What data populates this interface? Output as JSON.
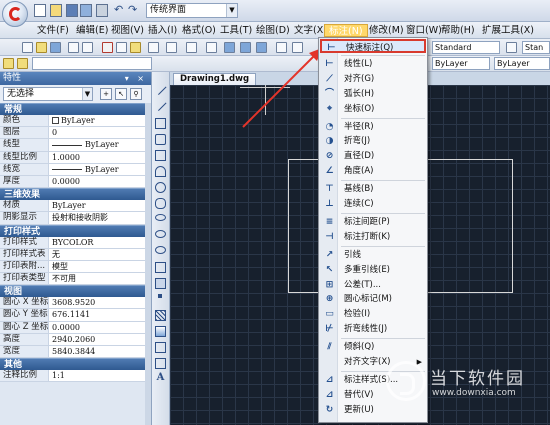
{
  "quick_access": {
    "workspace": "传统界面",
    "icons": [
      "new-icon",
      "open-icon",
      "save-icon",
      "saveas-icon",
      "print-icon",
      "undo-icon",
      "redo-icon"
    ]
  },
  "menubar": {
    "items": [
      "文件(F)",
      "编辑(E)",
      "视图(V)",
      "插入(I)",
      "格式(O)",
      "工具(T)",
      "绘图(D)",
      "文字(X)",
      "标注(N)",
      "修改(M)",
      "窗口(W)",
      "帮助(H)",
      "扩展工具(X)"
    ],
    "active_index": 8
  },
  "toolbar": {
    "style_combo": "Standard",
    "style_combo2": "Stan",
    "layer_combo": "ByLayer",
    "linetype_combo": "ByLayer"
  },
  "properties": {
    "title": "特性",
    "selection": "无选择",
    "sections": [
      {
        "name": "常规",
        "rows": [
          {
            "k": "颜色",
            "v": "ByLayer",
            "type": "color"
          },
          {
            "k": "图层",
            "v": "0",
            "type": "text"
          },
          {
            "k": "线型",
            "v": "ByLayer",
            "type": "rule"
          },
          {
            "k": "线型比例",
            "v": "1.0000",
            "type": "text"
          },
          {
            "k": "线宽",
            "v": "ByLayer",
            "type": "rule"
          },
          {
            "k": "厚度",
            "v": "0.0000",
            "type": "text"
          }
        ]
      },
      {
        "name": "三维效果",
        "rows": [
          {
            "k": "材质",
            "v": "ByLayer",
            "type": "text"
          },
          {
            "k": "阴影显示",
            "v": "投射和接收阴影",
            "type": "text"
          }
        ]
      },
      {
        "name": "打印样式",
        "rows": [
          {
            "k": "打印样式",
            "v": "BYCOLOR",
            "type": "text"
          },
          {
            "k": "打印样式表",
            "v": "无",
            "type": "text"
          },
          {
            "k": "打印表附...",
            "v": "模型",
            "type": "text"
          },
          {
            "k": "打印表类型",
            "v": "不可用",
            "type": "text"
          }
        ]
      },
      {
        "name": "视图",
        "rows": [
          {
            "k": "圆心 X 坐标",
            "v": "3608.9520",
            "type": "text"
          },
          {
            "k": "圆心 Y 坐标",
            "v": "676.1141",
            "type": "text"
          },
          {
            "k": "圆心 Z 坐标",
            "v": "0.0000",
            "type": "text"
          },
          {
            "k": "高度",
            "v": "2940.2060",
            "type": "text"
          },
          {
            "k": "宽度",
            "v": "5840.3844",
            "type": "text"
          }
        ]
      },
      {
        "name": "其他",
        "rows": [
          {
            "k": "注释比例",
            "v": "1:1",
            "type": "text"
          }
        ]
      }
    ]
  },
  "document": {
    "tab": "Drawing1.dwg"
  },
  "dim_menu": {
    "items": [
      {
        "label": "快速标注(Q)",
        "icon": "quick-dim-icon",
        "glyph": "⊢"
      },
      {
        "sep": true
      },
      {
        "label": "线性(L)",
        "icon": "linear-dim-icon",
        "glyph": "⊢"
      },
      {
        "label": "对齐(G)",
        "icon": "aligned-dim-icon",
        "glyph": "⟋"
      },
      {
        "label": "弧长(H)",
        "icon": "arc-length-icon",
        "glyph": "⌒"
      },
      {
        "label": "坐标(O)",
        "icon": "ordinate-icon",
        "glyph": "⌖"
      },
      {
        "sep": true
      },
      {
        "label": "半径(R)",
        "icon": "radius-icon",
        "glyph": "◔"
      },
      {
        "label": "折弯(J)",
        "icon": "jogged-icon",
        "glyph": "◑"
      },
      {
        "label": "直径(D)",
        "icon": "diameter-icon",
        "glyph": "⊘"
      },
      {
        "label": "角度(A)",
        "icon": "angular-icon",
        "glyph": "∠"
      },
      {
        "sep": true
      },
      {
        "label": "基线(B)",
        "icon": "baseline-icon",
        "glyph": "⊤"
      },
      {
        "label": "连续(C)",
        "icon": "continue-icon",
        "glyph": "⊥"
      },
      {
        "sep": true
      },
      {
        "label": "标注间距(P)",
        "icon": "dim-space-icon",
        "glyph": "≡"
      },
      {
        "label": "标注打断(K)",
        "icon": "dim-break-icon",
        "glyph": "⊣"
      },
      {
        "sep": true
      },
      {
        "label": "引线",
        "icon": "leader-icon",
        "glyph": "↗"
      },
      {
        "label": "多重引线(E)",
        "icon": "multileader-icon",
        "glyph": "↖"
      },
      {
        "label": "公差(T)...",
        "icon": "tolerance-icon",
        "glyph": "⊞"
      },
      {
        "label": "圆心标记(M)",
        "icon": "center-mark-icon",
        "glyph": "⊕"
      },
      {
        "label": "检验(I)",
        "icon": "inspect-icon",
        "glyph": "▭"
      },
      {
        "label": "折弯线性(J)",
        "icon": "jogged-linear-icon",
        "glyph": "⊬"
      },
      {
        "sep": true
      },
      {
        "label": "倾斜(Q)",
        "icon": "oblique-icon",
        "glyph": "⫽"
      },
      {
        "label": "对齐文字(X)",
        "icon": "align-text-icon",
        "glyph": "",
        "submenu": true
      },
      {
        "sep": true
      },
      {
        "label": "标注样式(S)...",
        "icon": "dim-style-icon",
        "glyph": "⊿"
      },
      {
        "label": "替代(V)",
        "icon": "override-icon",
        "glyph": "⊿"
      },
      {
        "label": "更新(U)",
        "icon": "update-icon",
        "glyph": "↻"
      }
    ]
  },
  "watermark": {
    "name": "当下软件园",
    "url": "www.downxia.com"
  }
}
